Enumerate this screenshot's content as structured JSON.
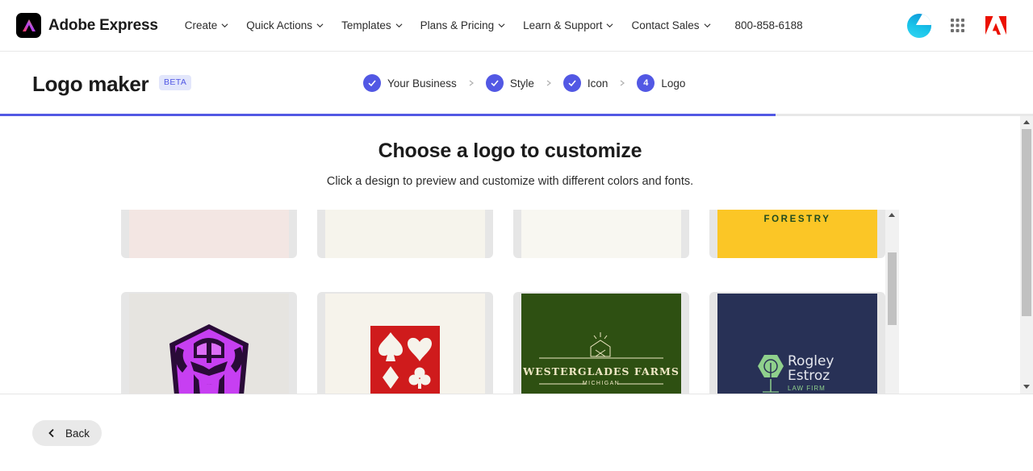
{
  "header": {
    "brand_name": "Adobe Express",
    "brand_icon": "adobe-express-logo-icon",
    "nav": [
      {
        "label": "Create"
      },
      {
        "label": "Quick Actions"
      },
      {
        "label": "Templates"
      },
      {
        "label": "Plans & Pricing"
      },
      {
        "label": "Learn & Support"
      },
      {
        "label": "Contact Sales"
      }
    ],
    "phone": "800-858-6188",
    "icons": [
      "avatar",
      "apps-grid-icon",
      "adobe-logo-icon"
    ]
  },
  "page": {
    "title": "Logo maker",
    "badge": "BETA",
    "steps": [
      {
        "label": "Your Business",
        "state": "done"
      },
      {
        "label": "Style",
        "state": "done"
      },
      {
        "label": "Icon",
        "state": "done"
      },
      {
        "label": "Logo",
        "state": "current",
        "number": "4"
      }
    ],
    "progress": 0.75,
    "accent_color": "#5258e4"
  },
  "main": {
    "title": "Choose a logo to customize",
    "subtitle": "Click a design to preview and customize with different colors and fonts.",
    "logos_row1": [
      {
        "bg": "#f3e6e3"
      },
      {
        "bg": "#f6f4ec"
      },
      {
        "bg": "#f8f7f1"
      },
      {
        "bg": "#fbc626",
        "text": "FORESTRY"
      }
    ],
    "logos_row2": [
      {
        "bg": "#e6e4e0",
        "icon": "viking-mascot-icon"
      },
      {
        "bg": "#f6f3eb",
        "icon": "card-suits-icon"
      },
      {
        "bg": "#2e5012",
        "name": "WESTERGLADES FARMS",
        "tagline": "MICHIGAN"
      },
      {
        "bg": "#283156",
        "name_line1": "Rogley",
        "name_line2": "Estroz",
        "tagline": "LAW FIRM"
      }
    ]
  },
  "footer": {
    "back_label": "Back"
  }
}
